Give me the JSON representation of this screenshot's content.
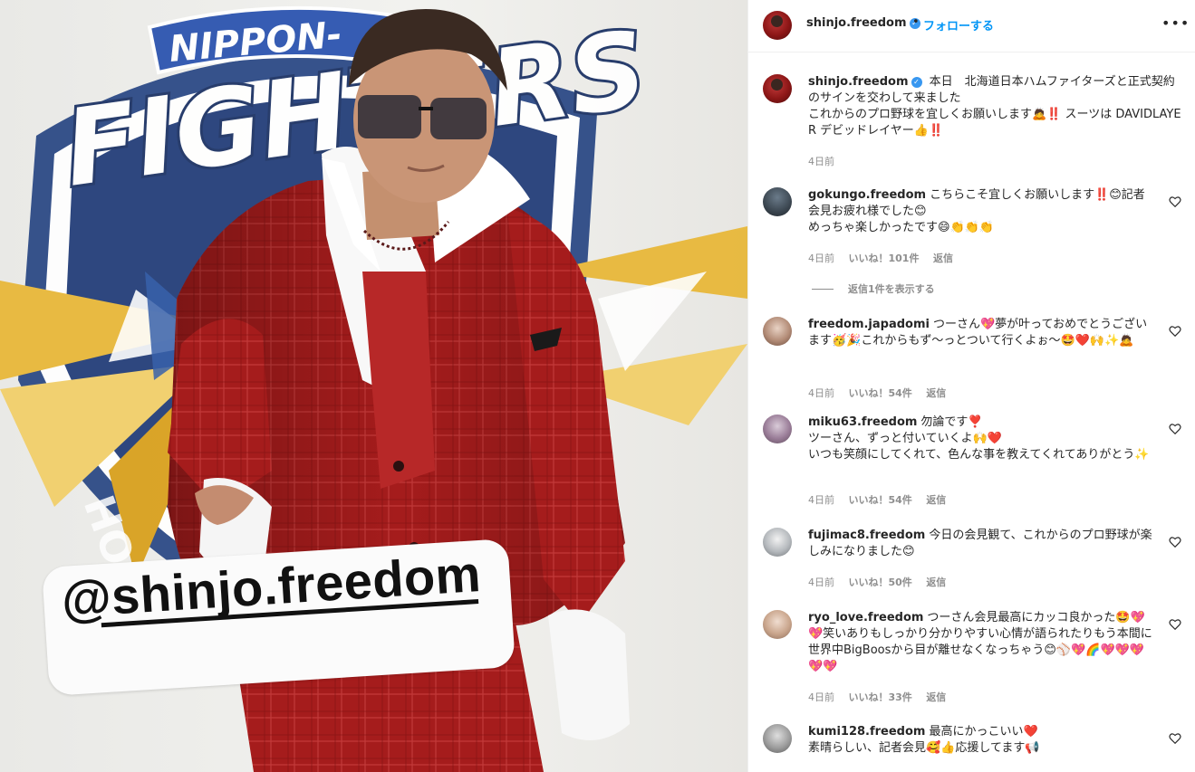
{
  "post": {
    "username": "shinjo.freedom",
    "separator": "•",
    "follow_label": "フォローする",
    "more_icon": "•••",
    "verified_mark": "✓"
  },
  "photo": {
    "banner_top": "NIPPON-",
    "banner_main": "FIGHTERS",
    "banner_side": "HO",
    "tag_text": "@shinjo.freedom"
  },
  "caption": {
    "username": "shinjo.freedom",
    "line1": "本日　北海道日本ハムファイターズと正式契約のサインを交わして来ました",
    "line2": "これからのプロ野球を宜しくお願いします🙇‼️ スーツは DAVIDLAYER デビッドレイヤー👍‼️",
    "time": "4日前"
  },
  "labels": {
    "like_prefix": "いいね！",
    "reply": "返信",
    "view_replies": "返信1件を表示する"
  },
  "comments": [
    {
      "username": "gokungo.freedom",
      "text": "こちらこそ宜しくお願いします‼️😊記者会見お疲れ様でした😊",
      "text2": "めっちゃ楽しかったです😄👏👏👏",
      "time": "4日前",
      "likes": "いいね！101件",
      "reply": "返信"
    },
    {
      "username": "freedom.japadomi",
      "text": "つーさん💖夢が叶っておめでとうございます🥳🎉これからもず〜っとついて行くよぉ〜🤩❤️🙌✨🙇",
      "time": "4日前",
      "likes": "いいね！54件",
      "reply": "返信"
    },
    {
      "username": "miku63.freedom",
      "text": "勿論です❣️",
      "text2": "ツーさん、ずっと付いていくよ🙌❤️",
      "text3": "いつも笑顔にしてくれて、色んな事を教えてくれてありがとう✨",
      "time": "4日前",
      "likes": "いいね！54件",
      "reply": "返信"
    },
    {
      "username": "fujimac8.freedom",
      "text": "今日の会見観て、これからのプロ野球が楽しみになりました😊",
      "time": "4日前",
      "likes": "いいね！50件",
      "reply": "返信"
    },
    {
      "username": "ryo_love.freedom",
      "text": "つーさん会見最高にカッコ良かった🤩💖💖笑いありもしっかり分かりやすい心情が語られたりもう本間に世界中BigBoosから目が離せなくなっちゃう😊⚾💖🌈💖💖💖💖💖",
      "time": "4日前",
      "likes": "いいね！33件",
      "reply": "返信"
    },
    {
      "username": "kumi128.freedom",
      "text": "最高にかっこいい❤️",
      "text2": "素晴らしい、記者会見🥰👍応援してます📢"
    }
  ],
  "colors": {
    "accent": "#0095f6",
    "verified": "#3897f0",
    "suit": "#a81d1d",
    "text": "#262626",
    "muted": "#8e8e8e"
  },
  "icons": [
    "heart-outline-icon",
    "verified-badge-icon",
    "more-options-icon"
  ]
}
